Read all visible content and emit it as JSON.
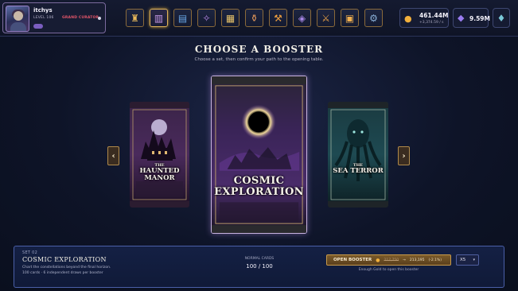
{
  "profile": {
    "username": "itchys",
    "level": "LEVEL 106",
    "rank": "GRAND CURATOR"
  },
  "nav": {
    "icons": [
      {
        "name": "castle-icon",
        "glyph": "♜"
      },
      {
        "name": "booster-pack-icon",
        "glyph": "▥"
      },
      {
        "name": "map-icon",
        "glyph": "▤"
      },
      {
        "name": "compass-icon",
        "glyph": "✧"
      },
      {
        "name": "scroll-icon",
        "glyph": "▦"
      },
      {
        "name": "bottle-icon",
        "glyph": "⚱"
      },
      {
        "name": "hammer-icon",
        "glyph": "⚒"
      },
      {
        "name": "rune-icon",
        "glyph": "◈"
      },
      {
        "name": "sword-icon",
        "glyph": "⚔"
      },
      {
        "name": "chest-icon",
        "glyph": "▣"
      },
      {
        "name": "gear-icon",
        "glyph": "⚙"
      }
    ],
    "active_index": 1
  },
  "resources": {
    "gold": "461.44M",
    "gold_rate": "+3,374.59 / s",
    "gems": "9.59M"
  },
  "header": {
    "title": "CHOOSE A BOOSTER",
    "subtitle": "Choose a set, then confirm your path to the opening table."
  },
  "packs": {
    "left": {
      "title_small": "THE",
      "title": "HAUNTED MANOR"
    },
    "center": {
      "title": "COSMIC EXPLORATION"
    },
    "right": {
      "title_small": "THE",
      "title": "SEA TERROR"
    }
  },
  "arrows": {
    "left": "‹",
    "right": "›"
  },
  "details": {
    "set_number": "SET 02",
    "set_name": "COSMIC EXPLORATION",
    "description": "Chart the constellations beyond the final horizon.",
    "meta": "100 cards · 6 independent draws per booster",
    "cards_label": "NORMAL CARDS",
    "cards_value": "100 / 100",
    "open_label": "OPEN BOOSTER",
    "price_old": "217,750",
    "price_arrow": "→",
    "price_new": "213,195",
    "price_discount": "(-2.1%)",
    "quantity": "X5",
    "gold_note": "Enough Gold to open this booster"
  },
  "colors": {
    "accent_gold": "#c89a4a",
    "panel_border": "#4a5fa8",
    "rank_red": "#e5566a",
    "coin": "#f2b03c",
    "gem": "#9a7cf0"
  }
}
